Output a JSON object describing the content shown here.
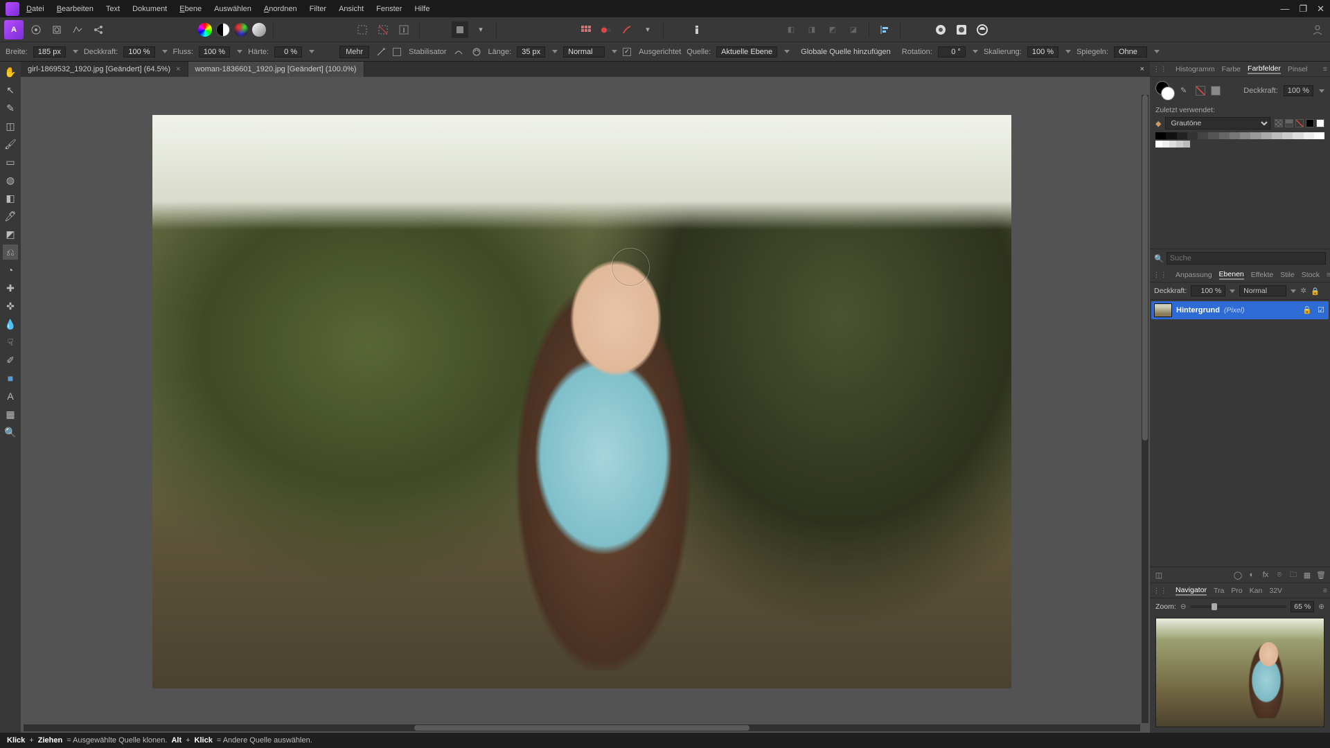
{
  "menubar": [
    "Datei",
    "Bearbeiten",
    "Text",
    "Dokument",
    "Ebene",
    "Auswählen",
    "Anordnen",
    "Filter",
    "Ansicht",
    "Fenster",
    "Hilfe"
  ],
  "menubar_accel": [
    "D",
    "B",
    "",
    "",
    "E",
    "",
    "A",
    "",
    "",
    "",
    ""
  ],
  "contextbar": {
    "breite_lbl": "Breite:",
    "breite_val": "185 px",
    "deckkraft_lbl": "Deckkraft:",
    "deckkraft_val": "100 %",
    "fluss_lbl": "Fluss:",
    "fluss_val": "100 %",
    "haerte_lbl": "Härte:",
    "haerte_val": "0 %",
    "mehr": "Mehr",
    "stabilisator": "Stabilisator",
    "laenge_lbl": "Länge:",
    "laenge_val": "35 px",
    "blend_val": "Normal",
    "ausgerichtet": "Ausgerichtet",
    "quelle_lbl": "Quelle:",
    "quelle_val": "Aktuelle Ebene",
    "globale": "Globale Quelle hinzufügen",
    "rotation_lbl": "Rotation:",
    "rotation_val": "0 °",
    "skalierung_lbl": "Skalierung:",
    "skalierung_val": "100 %",
    "spiegeln_lbl": "Spiegeln:",
    "spiegeln_val": "Ohne"
  },
  "tabs": [
    {
      "label": "girl-1869532_1920.jpg [Geändert] (64.5%)"
    },
    {
      "label": "woman-1836601_1920.jpg [Geändert] (100.0%)"
    }
  ],
  "right": {
    "top_tabs": [
      "Histogramm",
      "Farbe",
      "Farbfelder",
      "Pinsel"
    ],
    "opacity_lbl": "Deckkraft:",
    "opacity_val": "100 %",
    "recent_lbl": "Zuletzt verwendet:",
    "palette": "Grautöne",
    "search_ph": "Suche",
    "adjust_tabs": [
      "Anpassung",
      "Ebenen",
      "Effekte",
      "Stile",
      "Stock"
    ],
    "layer_opacity_lbl": "Deckkraft:",
    "layer_opacity_val": "100 %",
    "layer_blend": "Normal",
    "layer_name": "Hintergrund",
    "layer_type": "(Pixel)",
    "nav_tabs": [
      "Navigator",
      "Tra",
      "Pro",
      "Kan",
      "32V"
    ],
    "zoom_lbl": "Zoom:",
    "zoom_val": "65 %"
  },
  "status": {
    "s1a": "Klick",
    "s1b": "Ziehen",
    "s1t": " = Ausgewählte Quelle klonen. ",
    "s2a": "Alt",
    "s2b": "Klick",
    "s2t": " = Andere Quelle auswählen."
  }
}
